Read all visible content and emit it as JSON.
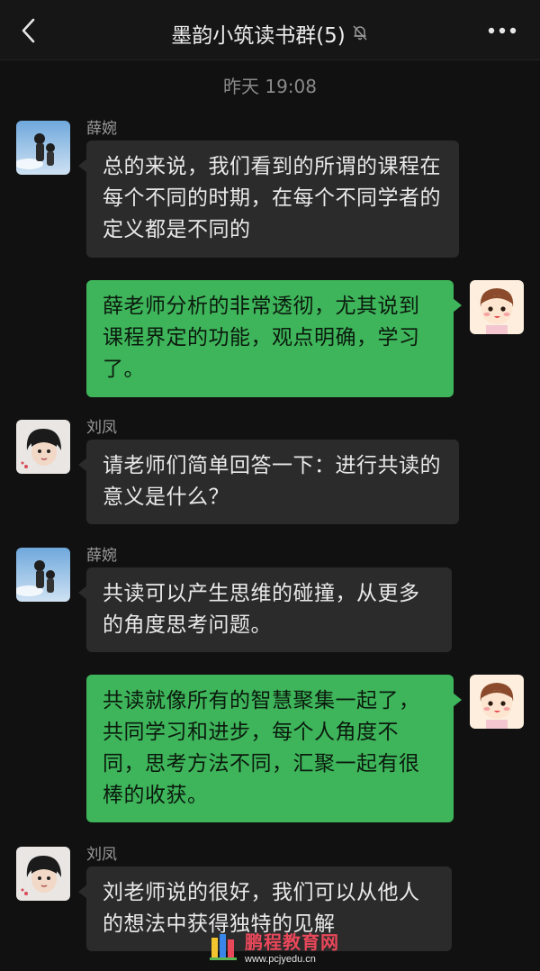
{
  "header": {
    "title": "墨韵小筑读书群(5)",
    "back_icon": "chevron-left-icon",
    "mute_icon": "bell-off-icon",
    "more_icon": "more-dots-icon"
  },
  "timestamp": "昨天 19:08",
  "messages": [
    {
      "sender": "薛婉",
      "direction": "incoming",
      "text": " 总的来说，我们看到的所谓的课程在每个不同的时期，在每个不同学者的定义都是不同的"
    },
    {
      "sender": "",
      "direction": "outgoing",
      "text": "薛老师分析的非常透彻，尤其说到课程界定的功能，观点明确，学习了。"
    },
    {
      "sender": "刘凤",
      "direction": "incoming",
      "text": " 请老师们简单回答一下：进行共读的意义是什么？"
    },
    {
      "sender": "薛婉",
      "direction": "incoming",
      "text": "共读可以产生思维的碰撞，从更多的角度思考问题。"
    },
    {
      "sender": "",
      "direction": "outgoing",
      "text": "共读就像所有的智慧聚集一起了，共同学习和进步，每个人角度不同，思考方法不同，汇聚一起有很棒的收获。"
    },
    {
      "sender": "刘凤",
      "direction": "incoming",
      "text": "刘老师说的很好，我们可以从他人的想法中获得独特的见解"
    }
  ],
  "watermark": {
    "name": "鹏程教育网",
    "url": "www.pcjyedu.cn"
  },
  "colors": {
    "background": "#111111",
    "incoming_bubble": "#2b2b2b",
    "outgoing_bubble": "#3eb55a"
  }
}
